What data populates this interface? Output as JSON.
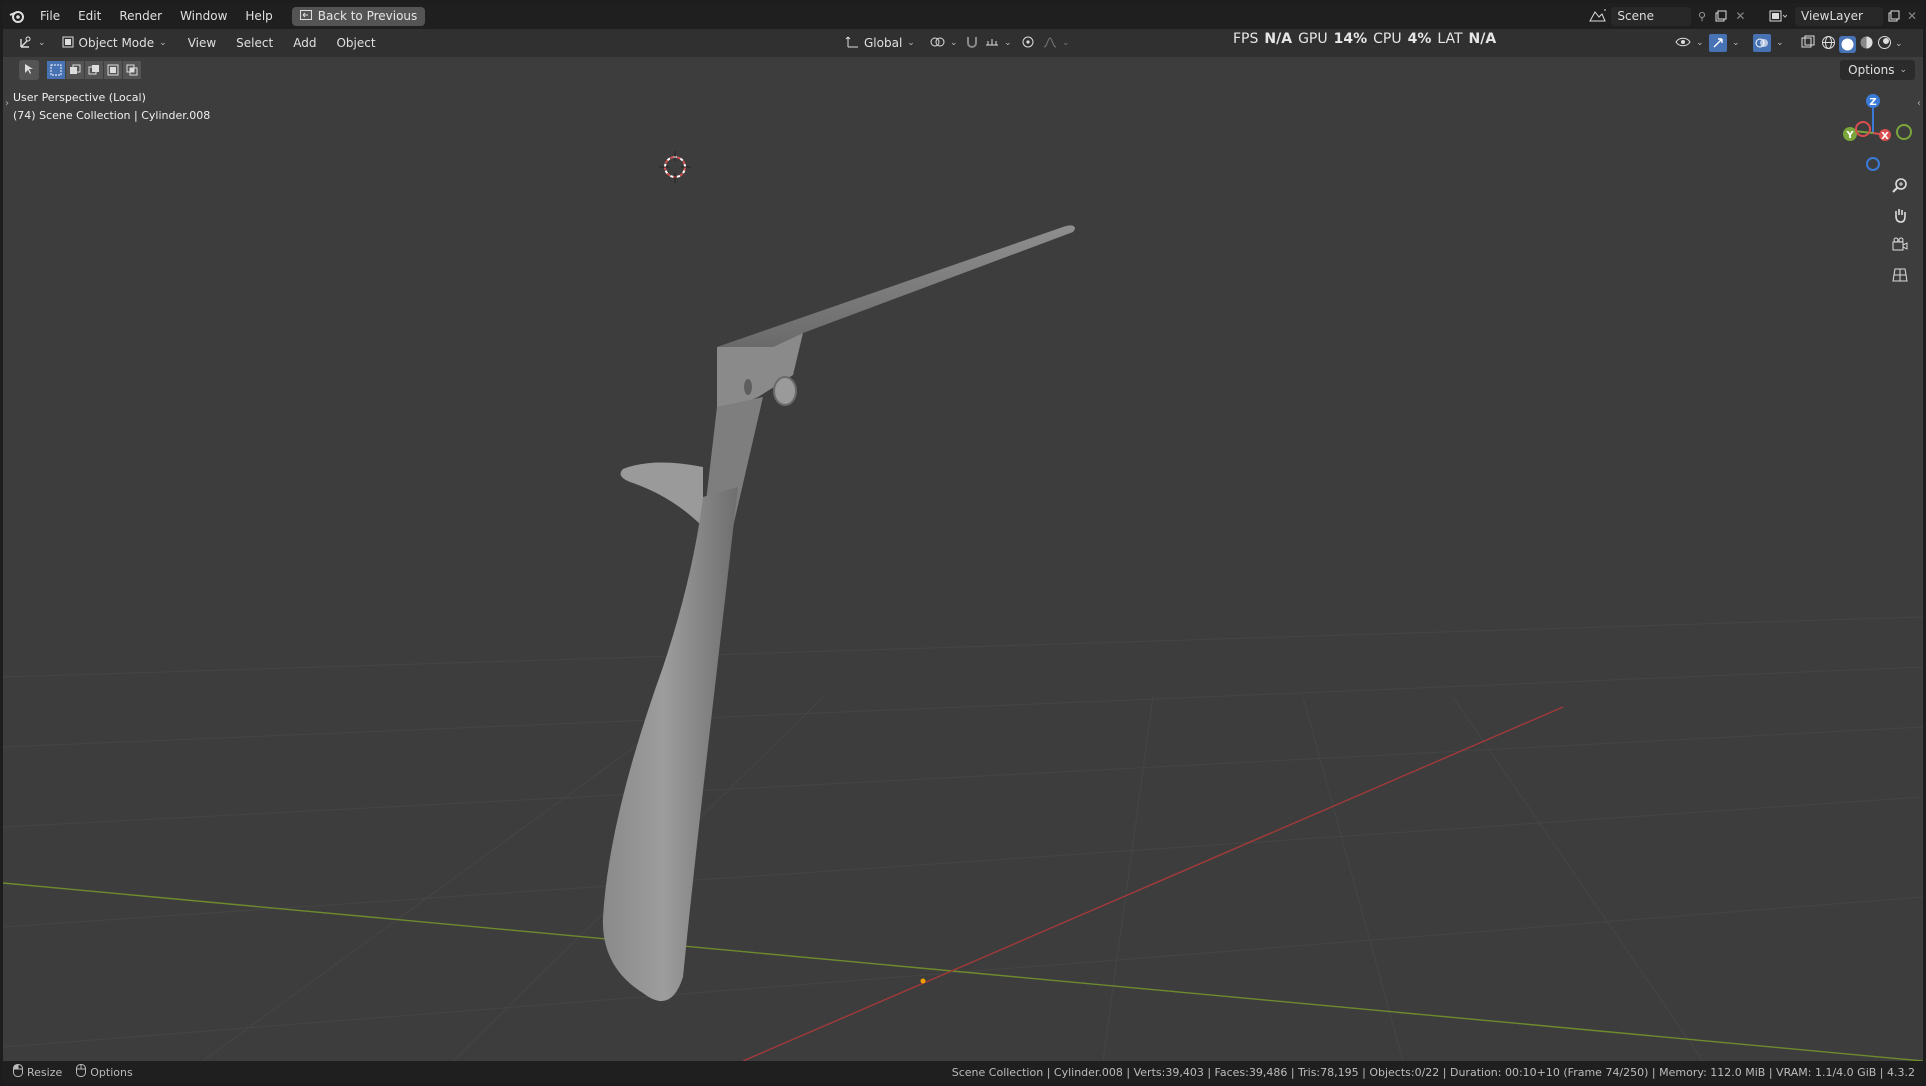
{
  "menubar": {
    "items": [
      "File",
      "Edit",
      "Render",
      "Window",
      "Help"
    ],
    "back_label": "Back to Previous",
    "scene_name": "Scene",
    "view_layer": "ViewLayer"
  },
  "performance": {
    "fps_label": "FPS",
    "fps_value": "N/A",
    "gpu_label": "GPU",
    "gpu_value": "14%",
    "cpu_label": "CPU",
    "cpu_value": "4%",
    "lat_label": "LAT",
    "lat_value": "N/A"
  },
  "header": {
    "mode": "Object Mode",
    "menus": [
      "View",
      "Select",
      "Add",
      "Object"
    ],
    "orientation": "Global",
    "options_label": "Options"
  },
  "viewport": {
    "perspective": "User Perspective (Local)",
    "collection_info": "(74) Scene Collection | Cylinder.008",
    "gizmo_axes": {
      "z": "Z",
      "y": "Y",
      "x": "X"
    }
  },
  "statusbar": {
    "resize_label": "Resize",
    "options_label": "Options",
    "stats": "Scene Collection | Cylinder.008 | Verts:39,403 | Faces:39,486 | Tris:78,195 | Objects:0/22 | Duration: 00:10+10 (Frame 74/250) | Memory: 112.0 MiB | VRAM: 1.1/4.0 GiB | 4.3.2"
  },
  "colors": {
    "x_axis": "#a23a3a",
    "y_axis": "#6d8a2d",
    "accent": "#4772b3"
  }
}
